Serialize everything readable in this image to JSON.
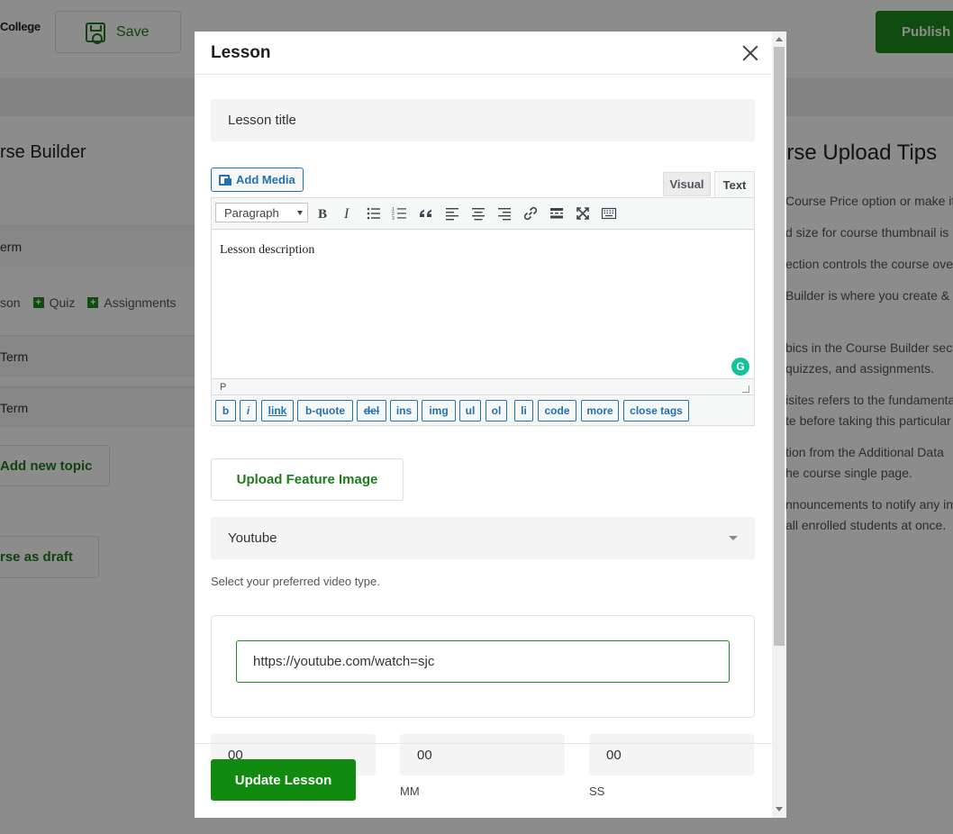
{
  "app": {
    "brand": "College",
    "save_label": "Save",
    "publish_label": "Publish C"
  },
  "builder": {
    "title": "rse Builder",
    "term_row_1": "erm",
    "content_links": {
      "lesson": "son",
      "quiz": "Quiz",
      "assignments": "Assignments"
    },
    "term_row_2": "Term",
    "term_row_3": "Term",
    "add_topic": "Add new topic",
    "draft": "rse as draft"
  },
  "tips": {
    "title": "urse Upload Tips",
    "items": [
      "Course Price option or make it",
      "d size for course thumbnail is",
      "ection controls the course over",
      "Builder is where you create &",
      "bics in the Course Builder secti",
      "quizzes, and assignments.",
      "isites refers to the fundamenta",
      "te before taking this particular",
      "tion from the Additional Data",
      "he course single page.",
      "nnouncements to notify any in",
      "all enrolled students at once."
    ]
  },
  "modal": {
    "title": "Lesson",
    "lesson_title_placeholder": "Lesson title",
    "add_media": "Add Media",
    "tabs": {
      "visual": "Visual",
      "text": "Text"
    },
    "format_select": "Paragraph",
    "description": "Lesson description",
    "status_path": "P",
    "grammarly": "G",
    "quicktags": [
      "b",
      "i",
      "link",
      "b-quote",
      "del",
      "ins",
      "img",
      "ul",
      "ol",
      "li",
      "code",
      "more",
      "close tags"
    ],
    "upload_feature_image": "Upload Feature Image",
    "video_source": "Youtube",
    "video_help": "Select your preferred video type.",
    "video_url": "https://youtube.com/watch=sjc",
    "duration": {
      "hh_value": "00",
      "mm_value": "00",
      "ss_value": "00",
      "mm_label": "MM",
      "ss_label": "SS"
    },
    "update_button": "Update Lesson"
  },
  "colors": {
    "brand_green": "#1e8a1e",
    "overlay": "rgba(0,0,0,0.45)",
    "wp_blue": "#2271b1",
    "grammarly": "#15c39a"
  }
}
